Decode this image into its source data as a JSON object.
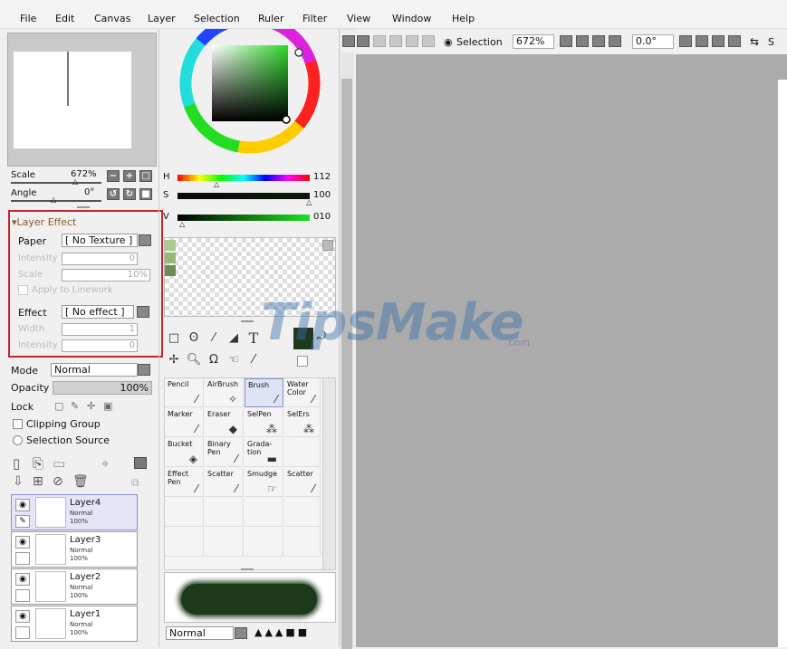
{
  "menu": [
    "File",
    "Edit",
    "Canvas",
    "Layer",
    "Selection",
    "Ruler",
    "Filter",
    "View",
    "Window",
    "Help"
  ],
  "navigator": {
    "scale_label": "Scale",
    "scale_value": "672%",
    "angle_label": "Angle",
    "angle_value": "0°"
  },
  "layer_effect": {
    "header": "Layer Effect",
    "paper_label": "Paper",
    "paper_value": "[ No Texture ]",
    "intensity_label": "Intensity",
    "intensity_value": "0",
    "scale_label": "Scale",
    "scale_value": "10%",
    "apply_linework": "Apply to Linework",
    "effect_label": "Effect",
    "effect_value": "[ No effect ]",
    "width_label": "Width",
    "width_value": "1",
    "intensity2_label": "Intensity",
    "intensity2_value": "0"
  },
  "layer_props": {
    "mode_label": "Mode",
    "mode_value": "Normal",
    "opacity_label": "Opacity",
    "opacity_value": "100%",
    "lock_label": "Lock",
    "clipping_group": "Clipping Group",
    "selection_source": "Selection Source"
  },
  "color": {
    "h_label": "H",
    "h_value": "112",
    "s_label": "S",
    "s_value": "100",
    "v_label": "V",
    "v_value": "010"
  },
  "tools": [
    {
      "name": "Pencil",
      "icon": "pencil-icon"
    },
    {
      "name": "AirBrush",
      "icon": "airbrush-icon"
    },
    {
      "name": "Brush",
      "icon": "brush-icon"
    },
    {
      "name": "Water Color",
      "icon": "watercolor-icon"
    },
    {
      "name": "Marker",
      "icon": "marker-icon"
    },
    {
      "name": "Eraser",
      "icon": "eraser-icon"
    },
    {
      "name": "SelPen",
      "icon": "selpen-icon"
    },
    {
      "name": "SelErs",
      "icon": "selers-icon"
    },
    {
      "name": "Bucket",
      "icon": "bucket-icon"
    },
    {
      "name": "Binary Pen",
      "icon": "binary-pen-icon"
    },
    {
      "name": "Grada-tion",
      "icon": "gradation-icon"
    },
    {
      "name": "Effect Pen",
      "icon": "effect-pen-icon"
    },
    {
      "name": "Scatter",
      "icon": "scatter-icon"
    },
    {
      "name": "Smudge",
      "icon": "smudge-icon"
    },
    {
      "name": "Scatter",
      "icon": "scatter2-icon"
    }
  ],
  "brush_mode": "Normal",
  "layers": [
    {
      "name": "Layer4",
      "mode": "Normal",
      "opacity": "100%"
    },
    {
      "name": "Layer3",
      "mode": "Normal",
      "opacity": "100%"
    },
    {
      "name": "Layer2",
      "mode": "Normal",
      "opacity": "100%"
    },
    {
      "name": "Layer1",
      "mode": "Normal",
      "opacity": "100%"
    }
  ],
  "toolbar": {
    "selection_label": "Selection",
    "zoom_value": "672%",
    "angle_value": "0.0°",
    "trailing_label": "S"
  },
  "watermark": {
    "text": "TipsMake",
    "suffix": ".com"
  },
  "colors": {
    "accent_box": "#c6252b",
    "canvas_gray": "#ababab",
    "brush_color": "#1c3a1a"
  }
}
